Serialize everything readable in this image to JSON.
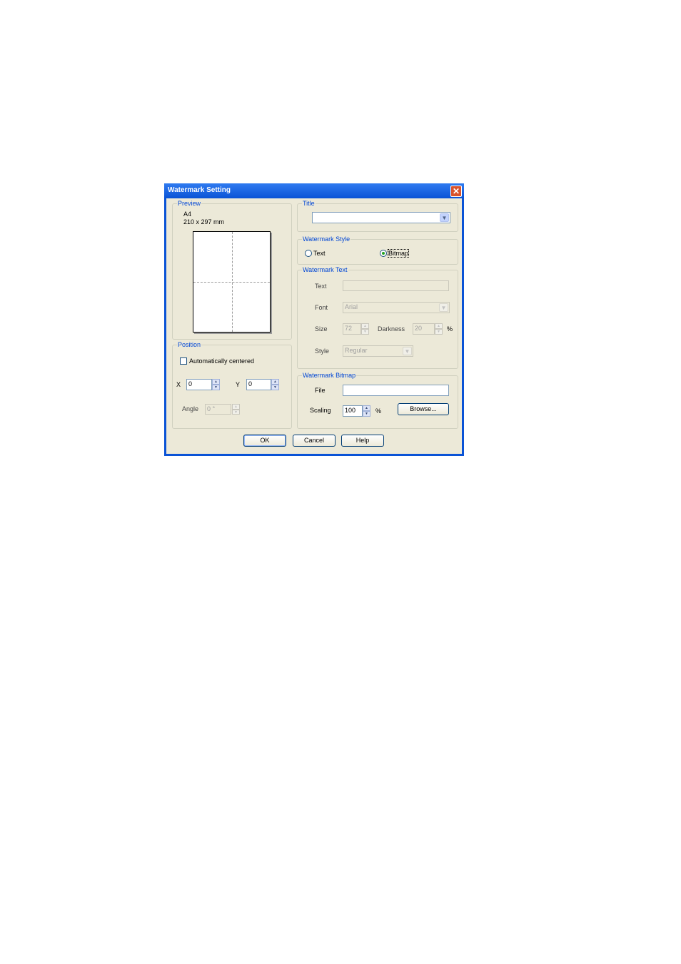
{
  "dialog": {
    "title": "Watermark Setting",
    "close_icon": "close-icon"
  },
  "preview": {
    "legend": "Preview",
    "paper_size": "A4",
    "dimensions": "210 x 297 mm"
  },
  "position": {
    "legend": "Position",
    "auto_centered_label": "Automatically centered",
    "auto_centered_checked": false,
    "x_label": "X",
    "x_value": "0",
    "y_label": "Y",
    "y_value": "0",
    "angle_label": "Angle",
    "angle_value": "0 °"
  },
  "title_group": {
    "legend": "Title",
    "selected_value": ""
  },
  "style_group": {
    "legend": "Watermark Style",
    "text_option": "Text",
    "bitmap_option": "Bitmap",
    "selected": "Bitmap"
  },
  "text_group": {
    "legend": "Watermark Text",
    "text_label": "Text",
    "text_value": "",
    "font_label": "Font",
    "font_value": "Arial",
    "size_label": "Size",
    "size_value": "72",
    "darkness_label": "Darkness",
    "darkness_value": "20",
    "darkness_unit": "%",
    "style_label": "Style",
    "style_value": "Regular"
  },
  "bitmap_group": {
    "legend": "Watermark Bitmap",
    "file_label": "File",
    "file_value": "",
    "scaling_label": "Scaling",
    "scaling_value": "100",
    "scaling_unit": "%",
    "browse_label": "Browse..."
  },
  "buttons": {
    "ok": "OK",
    "cancel": "Cancel",
    "help": "Help"
  }
}
